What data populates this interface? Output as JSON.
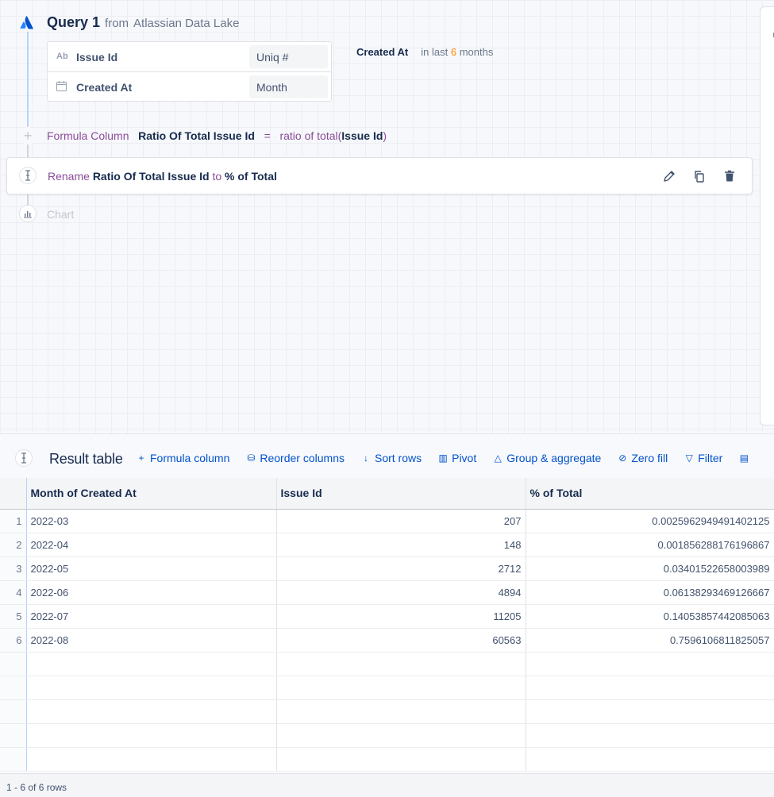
{
  "query": {
    "title": "Query 1",
    "source_prefix": "from",
    "source": "Atlassian Data Lake",
    "fields": [
      {
        "type_badge": "Ab",
        "icon": "calendar-icon",
        "name": "Issue Id",
        "aggregation": "Uniq #"
      },
      {
        "type_badge": "",
        "icon": "calendar-icon",
        "name": "Created At",
        "aggregation": "Month"
      }
    ],
    "filter": {
      "column": "Created At",
      "prefix": "in last",
      "number": "6",
      "unit": "months"
    }
  },
  "formula_step": {
    "keyword": "Formula Column",
    "column_name": "Ratio Of Total Issue Id",
    "equals": "=",
    "func": "ratio of total(",
    "arg": "Issue Id",
    "close": ")"
  },
  "rename_step": {
    "keyword": "Rename",
    "from": "Ratio Of Total Issue Id",
    "to_word": "to",
    "to": "% of Total"
  },
  "chart_step": {
    "label": "Chart"
  },
  "result": {
    "title": "Result table",
    "toolbar": [
      {
        "icon": "plus-icon",
        "label": "Formula column"
      },
      {
        "icon": "reorder-icon",
        "label": "Reorder columns"
      },
      {
        "icon": "sort-icon",
        "label": "Sort rows"
      },
      {
        "icon": "pivot-icon",
        "label": "Pivot"
      },
      {
        "icon": "group-icon",
        "label": "Group & aggregate"
      },
      {
        "icon": "zero-fill-icon",
        "label": "Zero fill"
      },
      {
        "icon": "filter-icon",
        "label": "Filter"
      }
    ],
    "columns": [
      "Month of Created At",
      "Issue Id",
      "% of Total"
    ],
    "rows": [
      [
        "2022-03",
        "207",
        "0.0025962949491402125"
      ],
      [
        "2022-04",
        "148",
        "0.001856288176196867"
      ],
      [
        "2022-05",
        "2712",
        "0.03401522658003989"
      ],
      [
        "2022-06",
        "4894",
        "0.06138293469126667"
      ],
      [
        "2022-07",
        "11205",
        "0.14053857442085063"
      ],
      [
        "2022-08",
        "60563",
        "0.7596106811825057"
      ]
    ],
    "footer": "1 - 6 of 6 rows"
  }
}
